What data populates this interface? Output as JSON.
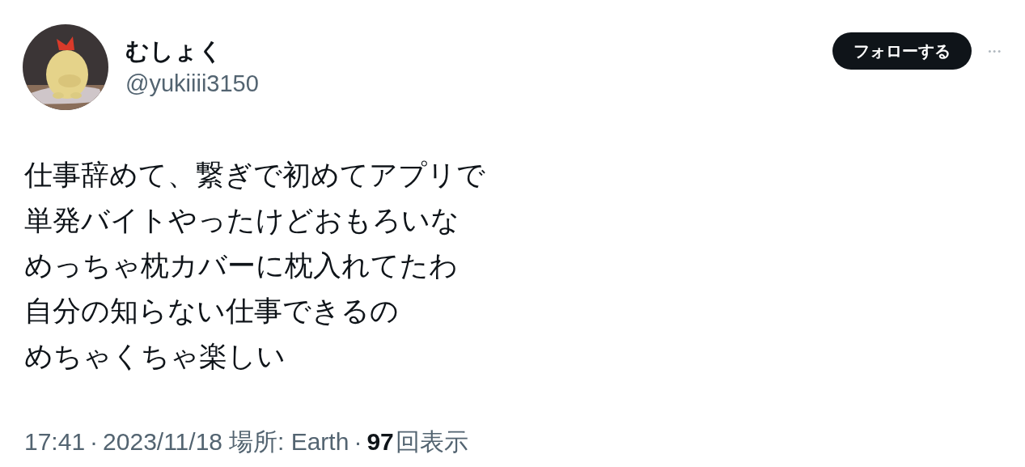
{
  "author": {
    "display_name": "むしょく",
    "handle": "@yukiiii3150"
  },
  "follow_button": {
    "label": "フォローする"
  },
  "more_button": {
    "label": "•••"
  },
  "tweet_lines": [
    "仕事辞めて、繋ぎで初めてアプリで",
    "単発バイトやったけどおもろいな",
    "めっちゃ枕カバーに枕入れてたわ",
    "自分の知らない仕事できるの",
    "めちゃくちゃ楽しい"
  ],
  "footer": {
    "time": "17:41",
    "separator_1": "·",
    "date": "2023/11/18",
    "location": "場所: Earth",
    "separator_2": "·",
    "views_count": "97",
    "views_label": "回表示"
  }
}
